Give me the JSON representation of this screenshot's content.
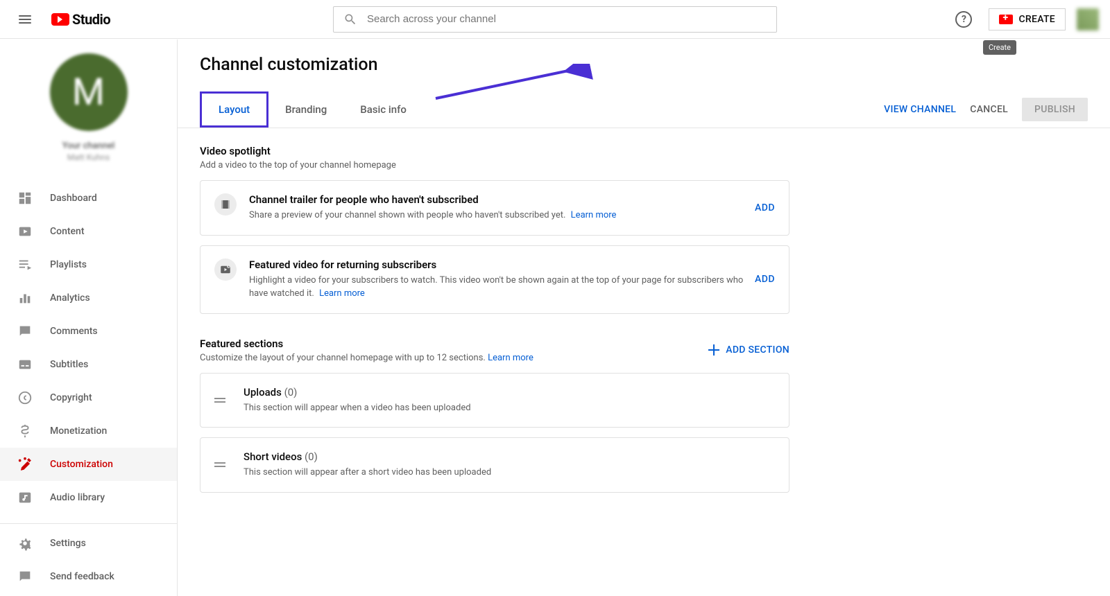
{
  "header": {
    "logo_text": "Studio",
    "search_placeholder": "Search across your channel",
    "create_label": "CREATE",
    "tooltip": "Create"
  },
  "sidebar": {
    "channel_label": "Your channel",
    "channel_name": "Matt Kuhns",
    "avatar_letter": "M",
    "items": [
      {
        "label": "Dashboard",
        "icon": "dashboard"
      },
      {
        "label": "Content",
        "icon": "content"
      },
      {
        "label": "Playlists",
        "icon": "playlists"
      },
      {
        "label": "Analytics",
        "icon": "analytics"
      },
      {
        "label": "Comments",
        "icon": "comments"
      },
      {
        "label": "Subtitles",
        "icon": "subtitles"
      },
      {
        "label": "Copyright",
        "icon": "copyright"
      },
      {
        "label": "Monetization",
        "icon": "monetization"
      },
      {
        "label": "Customization",
        "icon": "customization"
      },
      {
        "label": "Audio library",
        "icon": "audio"
      }
    ],
    "bottom": [
      {
        "label": "Settings",
        "icon": "settings"
      },
      {
        "label": "Send feedback",
        "icon": "feedback"
      }
    ]
  },
  "main": {
    "title": "Channel customization",
    "tabs": [
      {
        "label": "Layout"
      },
      {
        "label": "Branding"
      },
      {
        "label": "Basic info"
      }
    ],
    "actions": {
      "view": "VIEW CHANNEL",
      "cancel": "CANCEL",
      "publish": "PUBLISH"
    },
    "spotlight": {
      "title": "Video spotlight",
      "sub": "Add a video to the top of your channel homepage",
      "cards": [
        {
          "title": "Channel trailer for people who haven't subscribed",
          "desc": "Share a preview of your channel shown with people who haven't subscribed yet.",
          "learn": "Learn more",
          "add": "ADD"
        },
        {
          "title": "Featured video for returning subscribers",
          "desc": "Highlight a video for your subscribers to watch. This video won't be shown again at the top of your page for subscribers who have watched it.",
          "learn": "Learn more",
          "add": "ADD"
        }
      ]
    },
    "featured": {
      "title": "Featured sections",
      "sub": "Customize the layout of your channel homepage with up to 12 sections.",
      "learn": "Learn more",
      "add_btn": "ADD SECTION",
      "rows": [
        {
          "title": "Uploads",
          "count": "(0)",
          "desc": "This section will appear when a video has been uploaded"
        },
        {
          "title": "Short videos",
          "count": "(0)",
          "desc": "This section will appear after a short video has been uploaded"
        }
      ]
    }
  }
}
